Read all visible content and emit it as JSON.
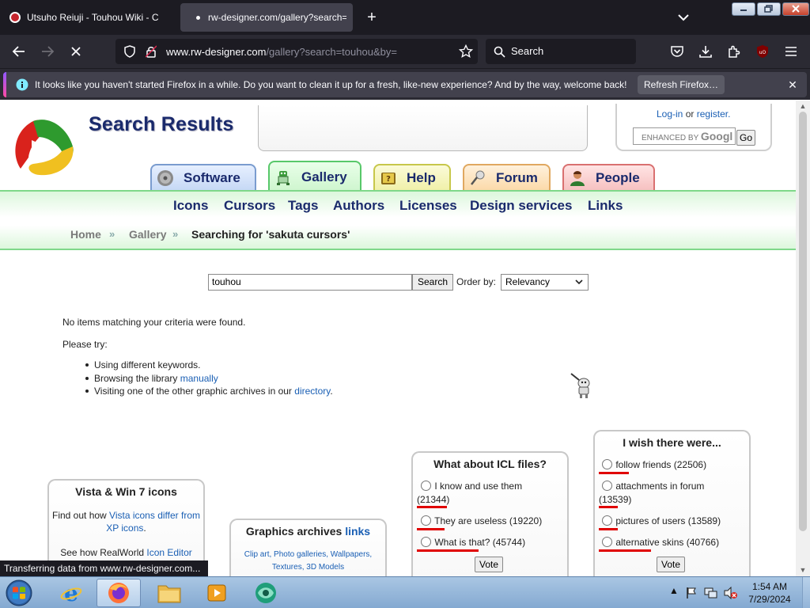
{
  "browser": {
    "tabs": [
      {
        "title": "Utsuho Reiuji - Touhou Wiki - C"
      },
      {
        "title": "rw-designer.com/gallery?search="
      }
    ],
    "url": {
      "host": "www.rw-designer.com",
      "path": "/gallery?search=touhou&by="
    },
    "search_placeholder": "Search",
    "notification": {
      "message": "It looks like you haven't started Firefox in a while. Do you want to clean it up for a fresh, like-new experience? And by the way, welcome back!",
      "button": "Refresh Firefox…"
    },
    "status": "Transferring data from www.rw-designer.com..."
  },
  "site": {
    "page_title": "Search Results",
    "login": {
      "login": "Log-in",
      "or": "or",
      "register": "register."
    },
    "google": {
      "label": "ENHANCED BY",
      "brand": "Googl",
      "go": "Go"
    },
    "tabs": [
      "Software",
      "Gallery",
      "Help",
      "Forum",
      "People"
    ],
    "menu": [
      "Icons",
      "Cursors",
      "Tags",
      "Authors",
      "Licenses",
      "Design services",
      "Links"
    ],
    "breadcrumb": {
      "home": "Home",
      "gallery": "Gallery",
      "current": "Searching for 'sakuta cursors'"
    }
  },
  "search": {
    "value": "touhou",
    "button": "Search",
    "order_label": "Order by:",
    "order_value": "Relevancy"
  },
  "results": {
    "none": "No items matching your criteria were found.",
    "try": "Please try:",
    "suggestions": [
      {
        "text": "Using different keywords."
      },
      {
        "text": "Browsing the library ",
        "link": "manually"
      },
      {
        "text": "Visiting one of the other graphic archives in our ",
        "link": "directory",
        "after": "."
      }
    ]
  },
  "boxes": {
    "vista": {
      "title": "Vista & Win 7 icons",
      "line1_pre": "Find out how ",
      "line1_link": "Vista icons differ from XP icons",
      "line1_post": ".",
      "line2_pre": "See how RealWorld ",
      "line2_link": "Icon Editor"
    },
    "graphics": {
      "title_pre": "Graphics archives ",
      "title_link": "links",
      "links": [
        "Clip art",
        "Photo galleries",
        "Wallpapers",
        "Textures",
        "3D Models"
      ]
    },
    "icl": {
      "title": "What about ICL files?",
      "options": [
        {
          "label": "I know and use them",
          "count": "(21344)"
        },
        {
          "label": "They are useless",
          "count": "(19220)"
        },
        {
          "label": "What is that?",
          "count": "(45744)"
        }
      ],
      "vote": "Vote"
    },
    "wish": {
      "title": "I wish there were...",
      "options": [
        {
          "label": "follow friends",
          "count": "(22506)"
        },
        {
          "label": "attachments in forum",
          "count": "(13539)"
        },
        {
          "label": "pictures of users",
          "count": "(13589)"
        },
        {
          "label": "alternative skins",
          "count": "(40766)"
        }
      ],
      "vote": "Vote"
    }
  },
  "taskbar": {
    "time": "1:54 AM",
    "date": "7/29/2024"
  },
  "colors": {
    "brand_navy": "#1a2a6c",
    "link_blue": "#1a5fb4",
    "annotation_red": "#e00000",
    "gallery_green": "#58c86a"
  }
}
